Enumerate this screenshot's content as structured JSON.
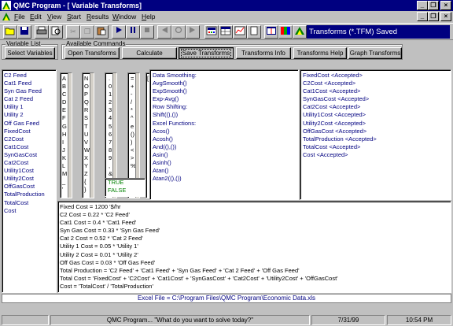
{
  "window": {
    "title": "QMC Program - [ Variable Transforms]"
  },
  "menu": {
    "items": [
      "File",
      "Edit",
      "View",
      "Start",
      "Results",
      "Window",
      "Help"
    ]
  },
  "toolbar": {
    "status_text": "Transforms (*.TFM) Saved"
  },
  "variable_list": {
    "legend": "Variable List",
    "select_button": "Select Variables",
    "items": [
      "C2 Feed",
      "Cat1 Feed",
      "Syn Gas Feed",
      "Cat 2 Feed",
      "Utility 1",
      "Utility 2",
      "Off Gas Feed",
      "FixedCost",
      "C2Cost",
      "Cat1Cost",
      "SynGasCost",
      "Cat2Cost",
      "Utility1Cost",
      "Utility2Cost",
      "OffGasCost",
      "TotalProduction",
      "TotalCost",
      "Cost"
    ]
  },
  "commands": {
    "legend": "Available Commands",
    "buttons": [
      "Open Transforms",
      "Calculate",
      "Save Transforms",
      "Transforms Info",
      "Transforms Help",
      "Graph Transforms"
    ]
  },
  "letters": {
    "col1": [
      "A",
      "B",
      "C",
      "D",
      "E",
      "F",
      "G",
      "H",
      "I",
      "J",
      "K",
      "L",
      "M",
      "_",
      "'"
    ],
    "col2": [
      "N",
      "O",
      "P",
      "Q",
      "R",
      "S",
      "T",
      "U",
      "V",
      "W",
      "X",
      "Y",
      "Z",
      "{",
      "}"
    ],
    "col3": [
      ".",
      "0",
      "1",
      "2",
      "3",
      "4",
      "5",
      "6",
      "7",
      "8",
      "9",
      ",",
      "&"
    ],
    "col4": [
      "=",
      "+",
      "-",
      "/",
      "*",
      "^",
      "e",
      "()",
      ")",
      "<",
      ">",
      "%"
    ],
    "col5": [
      "",
      "",
      "",
      "",
      "",
      "",
      "",
      "",
      "",
      "",
      "",
      "",
      "",
      "",
      "["
    ]
  },
  "booleans": [
    "TRUE",
    "FALSE"
  ],
  "functions": [
    "Data Smoothing:",
    "AvgSmooth()",
    "ExpSmooth()",
    "Exp-Avg()",
    "",
    "Row Shifting:",
    "Shift((),())",
    "",
    "Excel Functions:",
    "Acos()",
    "Acosh()",
    "And((),())",
    "Asin()",
    "Asinh()",
    "Atan()",
    "Atan2((),())"
  ],
  "accepted": [
    "FixedCost <Accepted>",
    "C2Cost <Accepted>",
    "Cat1Cost <Accepted>",
    "SynGasCost <Accepted>",
    "Cat2Cost <Accepted>",
    "Utility1Cost <Accepted>",
    "Utility2Cost <Accepted>",
    "OffGasCost <Accepted>",
    "TotalProduction <Accepted>",
    "TotalCost <Accepted>",
    "Cost <Accepted>"
  ],
  "formulas": [
    "Fixed Cost = 1200 '$/hr",
    "C2 Cost = 0.22 * 'C2 Feed'",
    "Cat1 Cost = 0.4 * 'Cat1 Feed'",
    "Syn Gas Cost = 0.33 * 'Syn Gas Feed'",
    "Cat 2 Cost = 0.52 * 'Cat 2 Feed'",
    "Utility 1 Cost = 0.05 * 'Utility 1'",
    "Utility 2 Cost = 0.01 * 'Utility 2'",
    "Off Gas Cost = 0.03 * 'Off Gas Feed'",
    "Total Production = 'C2 Feed' + 'Cat1 Feed' + 'Syn Gas Feed' + 'Cat 2 Feed' + 'Off Gas Feed'",
    "Total Cost = 'FixedCost' + 'C2Cost' + 'Cat1Cost' + 'SynGasCost' + 'Cat2Cost' + 'Utility2Cost' + 'OffGasCost'",
    "Cost = 'TotalCost' / 'TotalProduction'"
  ],
  "excel_file": "Excel File = C:\\Program Files\\QMC Program\\Economic Data.xls",
  "statusbar": {
    "message": "QMC Program... \"What do you want to solve today?\"",
    "date": "7/31/99",
    "time": "10:54 PM"
  }
}
